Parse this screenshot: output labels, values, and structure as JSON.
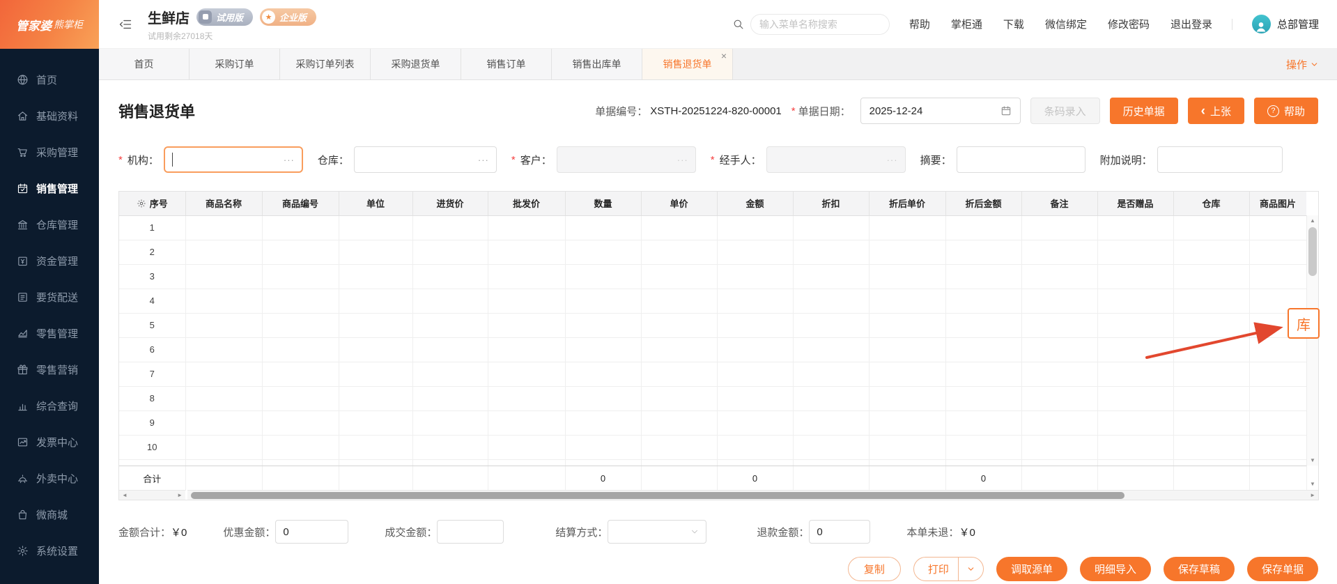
{
  "brand": {
    "name_primary": "管家婆",
    "name_secondary": "熊掌柜"
  },
  "topbar": {
    "store_name": "生鲜店",
    "trial_remaining": "试用剩余27018天",
    "badge_trial": "试用版",
    "badge_enterprise": "企业版",
    "search_placeholder": "输入菜单名称搜索",
    "links": [
      "帮助",
      "掌柜通",
      "下载",
      "微信绑定",
      "修改密码",
      "退出登录"
    ],
    "user_name": "总部管理"
  },
  "sidebar": {
    "active_index": 3,
    "items": [
      {
        "label": "首页",
        "icon": "globe-icon",
        "slug": "home"
      },
      {
        "label": "基础资料",
        "icon": "home-icon",
        "slug": "basic-data"
      },
      {
        "label": "采购管理",
        "icon": "cart-icon",
        "slug": "purchase"
      },
      {
        "label": "销售管理",
        "icon": "calendar-check-icon",
        "slug": "sales"
      },
      {
        "label": "仓库管理",
        "icon": "bank-icon",
        "slug": "warehouse"
      },
      {
        "label": "资金管理",
        "icon": "money-calendar-icon",
        "slug": "funds"
      },
      {
        "label": "要货配送",
        "icon": "list-icon",
        "slug": "delivery"
      },
      {
        "label": "零售管理",
        "icon": "area-chart-icon",
        "slug": "retail"
      },
      {
        "label": "零售营销",
        "icon": "gift-icon",
        "slug": "retail-marketing"
      },
      {
        "label": "综合查询",
        "icon": "bar-chart-icon",
        "slug": "query"
      },
      {
        "label": "发票中心",
        "icon": "trend-icon",
        "slug": "invoice"
      },
      {
        "label": "外卖中心",
        "icon": "bell-icon",
        "slug": "takeout"
      },
      {
        "label": "微商城",
        "icon": "bag-icon",
        "slug": "micro-mall"
      },
      {
        "label": "系统设置",
        "icon": "gear-icon",
        "slug": "settings"
      }
    ]
  },
  "tabs": {
    "active": "销售退货单",
    "items": [
      "首页",
      "采购订单",
      "采购订单列表",
      "采购退货单",
      "销售订单",
      "销售出库单",
      "销售退货单"
    ],
    "action_label": "操作"
  },
  "form": {
    "title": "销售退货单",
    "doc_no_label": "单据编号：",
    "doc_no": "XSTH-20251224-820-00001",
    "doc_date_label": "单据日期：",
    "doc_date": "2025-12-24",
    "barcode_button": "条码录入",
    "history_button": "历史单据",
    "prev_button": "上张",
    "help_button": "帮助",
    "fields": [
      {
        "label": "机构：",
        "slug": "org",
        "required": true,
        "state": "focus"
      },
      {
        "label": "仓库：",
        "slug": "warehouse",
        "required": false,
        "state": "normal"
      },
      {
        "label": "客户：",
        "slug": "customer",
        "required": true,
        "state": "disabled"
      },
      {
        "label": "经手人：",
        "slug": "handler",
        "required": true,
        "state": "disabled"
      },
      {
        "label": "摘要：",
        "slug": "remark",
        "required": false,
        "state": "plain"
      },
      {
        "label": "附加说明：",
        "slug": "extra-note",
        "required": false,
        "state": "plain"
      }
    ]
  },
  "table": {
    "headers": [
      "序号",
      "商品名称",
      "商品编号",
      "单位",
      "进货价",
      "批发价",
      "数量",
      "单价",
      "金额",
      "折扣",
      "折后单价",
      "折后金额",
      "备注",
      "是否赠品",
      "仓库",
      "商品图片"
    ],
    "rows": [
      "1",
      "2",
      "3",
      "4",
      "5",
      "6",
      "7",
      "8",
      "9",
      "10"
    ],
    "totals": {
      "label": "合计",
      "qty": "0",
      "amount": "0",
      "discounted_amount": "0"
    }
  },
  "summary": {
    "amount_total_label": "金额合计：",
    "amount_total_value": "￥0",
    "discount_label": "优惠金额：",
    "discount_value": "0",
    "deal_label": "成交金额：",
    "deal_value": "",
    "settle_label": "结算方式：",
    "settle_value": "",
    "refund_label": "退款金额：",
    "refund_value": "0",
    "unreturned_label": "本单未退：",
    "unreturned_value": "￥0"
  },
  "footer": {
    "copy": "复制",
    "print": "打印",
    "fetch_source": "调取源单",
    "detail_import": "明细导入",
    "save_draft": "保存草稿",
    "save_doc": "保存单据"
  },
  "annotation": {
    "label": "库"
  },
  "glyphs": {
    "star": "*",
    "close": "×",
    "prev": "‹",
    "question": "?",
    "ellipsis": "···",
    "up": "▲",
    "down": "▼",
    "left": "◄",
    "right": "►",
    "badge_star": "★"
  },
  "colors": {
    "primary": "#f7762b",
    "sidebar_bg": "#0c1b2d",
    "required": "#f53f3f",
    "annotation_arrow": "#e2472e"
  }
}
